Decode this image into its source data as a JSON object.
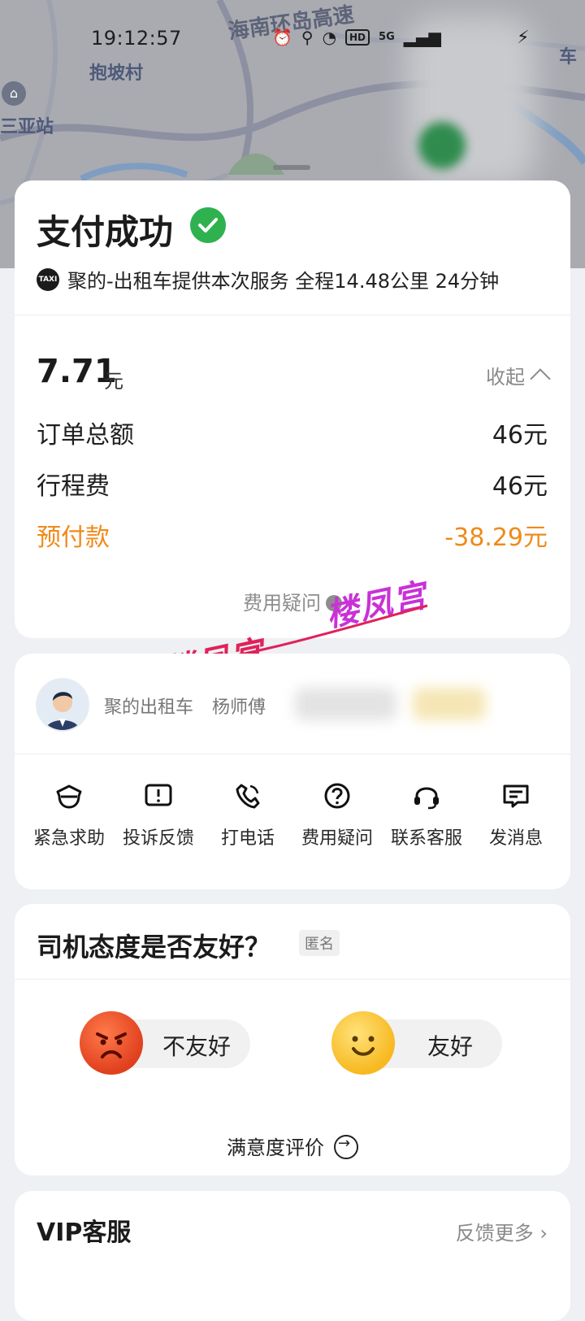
{
  "status_bar": {
    "time": "19:12:57",
    "icons": [
      "alarm-icon",
      "location-icon",
      "wifi-icon",
      "hd-icon",
      "signal-5g-icon",
      "signal-3g-icon",
      "charging-icon"
    ],
    "hd_text": "HD",
    "net_text": "5G"
  },
  "map": {
    "labels": [
      "海南环岛高速",
      "抱坡村",
      "三亚站",
      "车"
    ]
  },
  "payment": {
    "title": "支付成功",
    "service": "聚的-出租车提供本次服务 全程14.48公里 24分钟",
    "taxi_badge": "TAXI",
    "amount": "7.71",
    "amount_unit": "元",
    "collapse_label": "收起",
    "fees": [
      {
        "label": "订单总额",
        "value": "46元"
      },
      {
        "label": "行程费",
        "value": "46元"
      },
      {
        "label": "预付款",
        "value": "-38.29元",
        "highlight": "#f08a1a"
      }
    ],
    "fee_question": "费用疑问"
  },
  "watermark": {
    "text1": "楼凤宫",
    "text2": "楼凤宫"
  },
  "driver": {
    "company": "聚的出租车",
    "name": "杨师傅",
    "actions": [
      {
        "label": "紧急求助",
        "icon": "police-icon"
      },
      {
        "label": "投诉反馈",
        "icon": "complaint-icon"
      },
      {
        "label": "打电话",
        "icon": "phone-icon"
      },
      {
        "label": "费用疑问",
        "icon": "question-icon"
      },
      {
        "label": "联系客服",
        "icon": "headset-icon"
      },
      {
        "label": "发消息",
        "icon": "message-icon"
      }
    ]
  },
  "rating": {
    "title": "司机态度是否友好？",
    "anon": "匿名",
    "unfriendly": "不友好",
    "friendly": "友好",
    "satisfaction": "满意度评价"
  },
  "vip": {
    "title": "VIP客服",
    "more": "反馈更多"
  },
  "colors": {
    "accent_orange": "#f08a1a",
    "success_green": "#2fb14f",
    "card_bg": "#ffffff",
    "page_bg": "#eef0f3"
  }
}
